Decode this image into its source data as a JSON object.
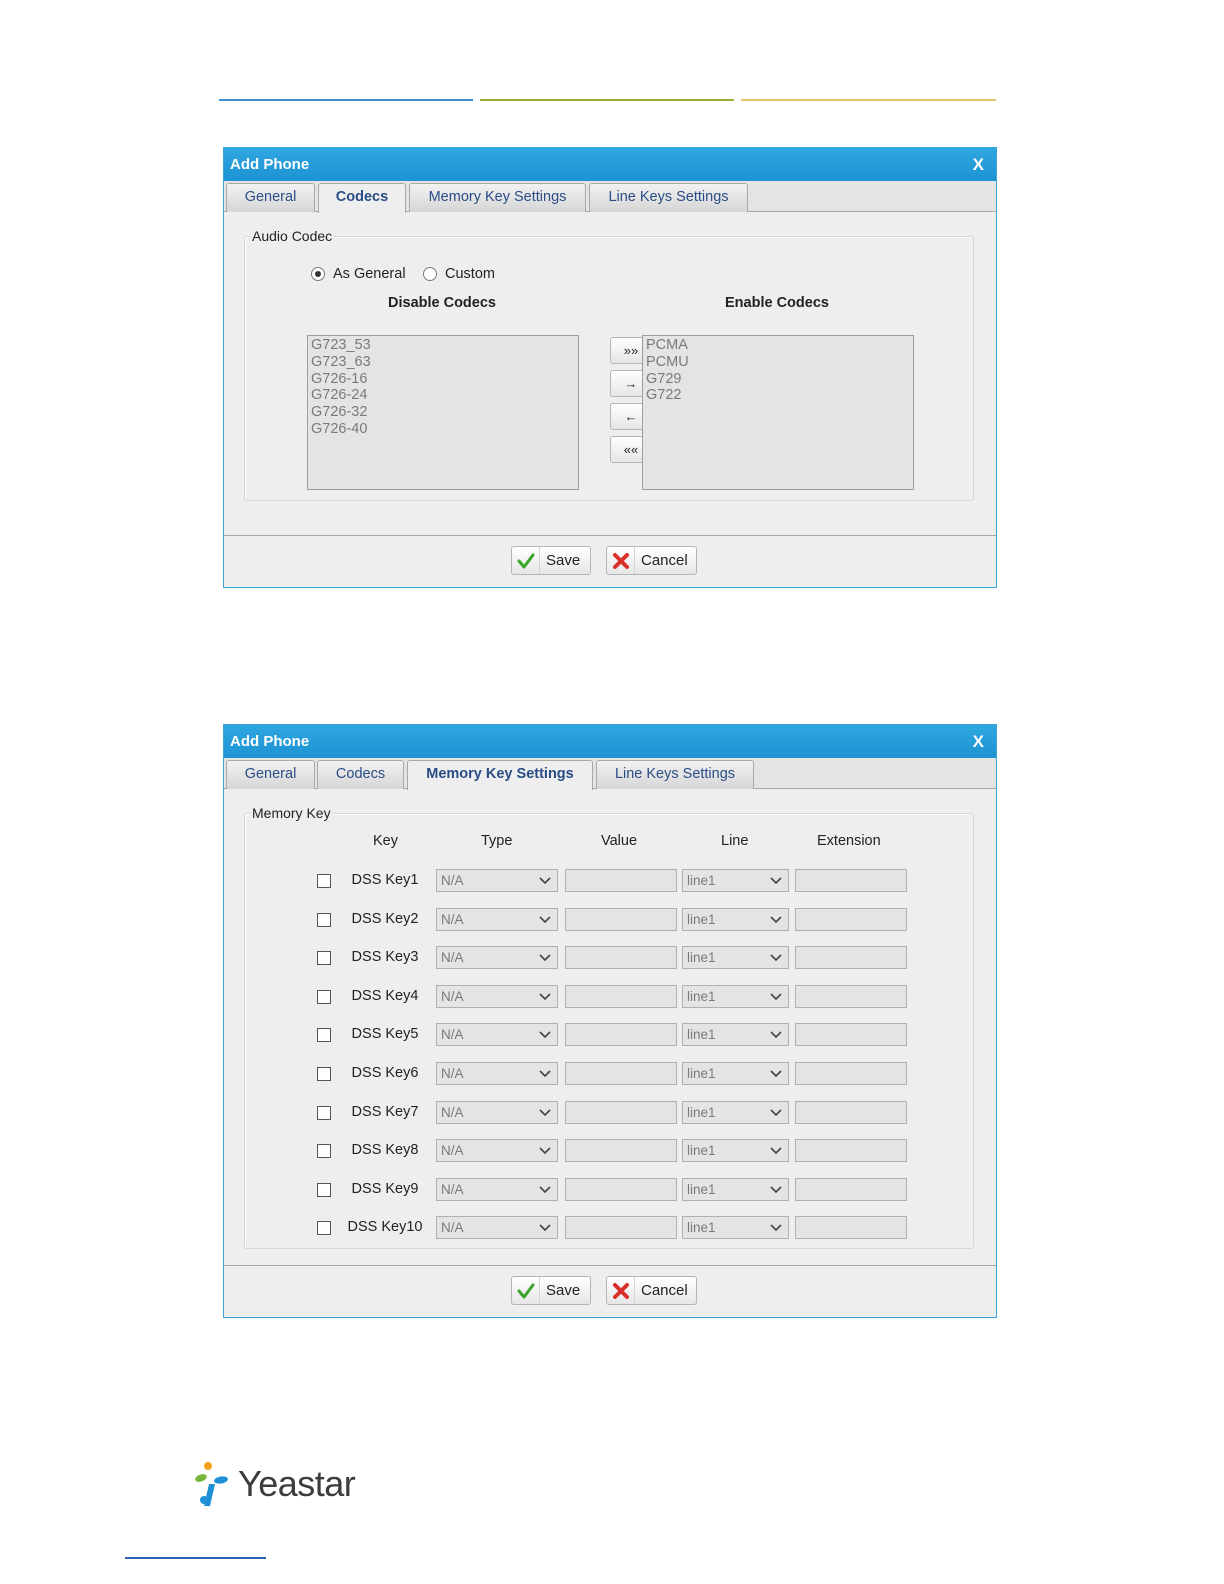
{
  "dialog1": {
    "title": "Add Phone",
    "close": "X",
    "tabs": [
      "General",
      "Codecs",
      "Memory Key Settings",
      "Line Keys Settings"
    ],
    "active_tab": "Codecs",
    "section_title": "Audio Codec",
    "radio_as_general": "As General",
    "radio_custom": "Custom",
    "selected_radio": "As General",
    "disable_header": "Disable Codecs",
    "enable_header": "Enable Codecs",
    "disable_codecs": [
      "G723_53",
      "G723_63",
      "G726-16",
      "G726-24",
      "G726-32",
      "G726-40"
    ],
    "enable_codecs": [
      "PCMA",
      "PCMU",
      "G729",
      "G722"
    ],
    "move_all_right": "»»",
    "move_right": "→",
    "move_left": "←",
    "move_all_left": "««",
    "save": "Save",
    "cancel": "Cancel"
  },
  "dialog2": {
    "title": "Add Phone",
    "close": "X",
    "tabs": [
      "General",
      "Codecs",
      "Memory Key Settings",
      "Line Keys Settings"
    ],
    "active_tab": "Memory Key Settings",
    "section_title": "Memory Key",
    "columns": {
      "key": "Key",
      "type": "Type",
      "value": "Value",
      "line": "Line",
      "extension": "Extension"
    },
    "rows": [
      {
        "key": "DSS Key1",
        "type": "N/A",
        "value": "",
        "line": "line1",
        "extension": ""
      },
      {
        "key": "DSS Key2",
        "type": "N/A",
        "value": "",
        "line": "line1",
        "extension": ""
      },
      {
        "key": "DSS Key3",
        "type": "N/A",
        "value": "",
        "line": "line1",
        "extension": ""
      },
      {
        "key": "DSS Key4",
        "type": "N/A",
        "value": "",
        "line": "line1",
        "extension": ""
      },
      {
        "key": "DSS Key5",
        "type": "N/A",
        "value": "",
        "line": "line1",
        "extension": ""
      },
      {
        "key": "DSS Key6",
        "type": "N/A",
        "value": "",
        "line": "line1",
        "extension": ""
      },
      {
        "key": "DSS Key7",
        "type": "N/A",
        "value": "",
        "line": "line1",
        "extension": ""
      },
      {
        "key": "DSS Key8",
        "type": "N/A",
        "value": "",
        "line": "line1",
        "extension": ""
      },
      {
        "key": "DSS Key9",
        "type": "N/A",
        "value": "",
        "line": "line1",
        "extension": ""
      },
      {
        "key": "DSS Key10",
        "type": "N/A",
        "value": "",
        "line": "line1",
        "extension": ""
      }
    ],
    "save": "Save",
    "cancel": "Cancel"
  },
  "logo": {
    "text": "Yeastar"
  },
  "colors": {
    "titlebar": "#1d93d3",
    "tab_text": "#2a4d86",
    "save_check": "#3aa52a",
    "cancel_x": "#d9302a"
  },
  "icons": {
    "save": "check-icon",
    "cancel": "x-icon",
    "dropdown": "chevron-down-icon",
    "logo": "yeastar-pinwheel-icon"
  }
}
